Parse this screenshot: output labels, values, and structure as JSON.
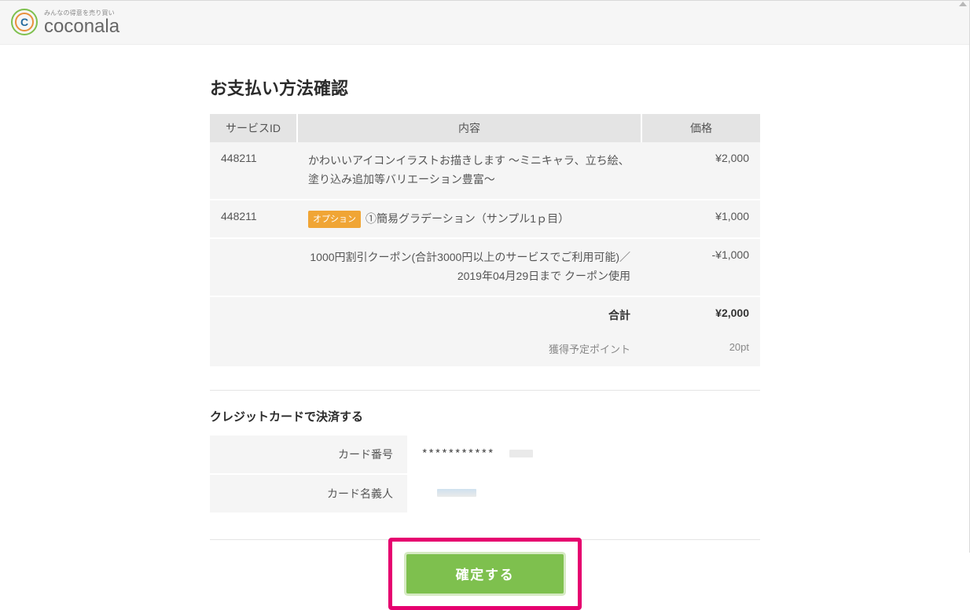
{
  "brand": {
    "tagline": "みんなの得意を売り買い",
    "name": "coconala"
  },
  "page": {
    "title": "お支払い方法確認"
  },
  "order": {
    "headers": {
      "id": "サービスID",
      "content": "内容",
      "price": "価格"
    },
    "items": [
      {
        "id": "448211",
        "desc": "かわいいアイコンイラストお描きします ～ミニキャラ、立ち絵、塗り込み追加等バリエーション豊富～",
        "price": "¥2,000"
      },
      {
        "id": "448211",
        "option_badge": "オプション",
        "desc": "①簡易グラデーション（サンプル1ｐ目）",
        "price": "¥1,000"
      }
    ],
    "coupon": {
      "desc": "1000円割引クーポン(合計3000円以上のサービスでご利用可能)／2019年04月29日まで クーポン使用",
      "price": "-¥1,000"
    },
    "total": {
      "label": "合計",
      "price": "¥2,000"
    },
    "points": {
      "label": "獲得予定ポイント",
      "value": "20pt"
    }
  },
  "card": {
    "section_title": "クレジットカードで決済する",
    "number_label": "カード番号",
    "number_value": "***********",
    "name_label": "カード名義人",
    "name_value": ""
  },
  "confirm": {
    "label": "確定する"
  }
}
